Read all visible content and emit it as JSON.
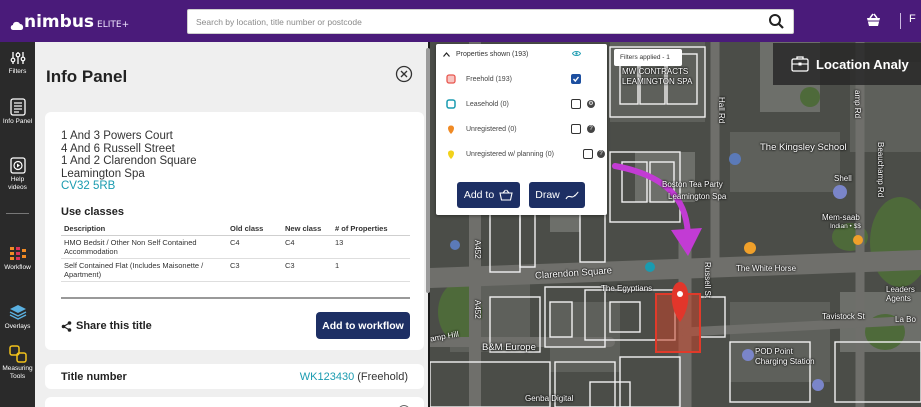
{
  "app": {
    "logo_text": "nimbus",
    "logo_badge": "ELITE+"
  },
  "search": {
    "placeholder": "Search by location, title number or postcode"
  },
  "topbar": {
    "trailing_text": "F"
  },
  "sidebar": {
    "items": [
      {
        "label": "Filters",
        "icon": "filters-icon"
      },
      {
        "label": "Info Panel",
        "icon": "info-panel-icon"
      },
      {
        "label": "Help videos",
        "icon": "help-videos-icon"
      },
      {
        "label": "Workflow",
        "icon": "workflow-icon"
      },
      {
        "label": "Overlays",
        "icon": "overlays-icon"
      },
      {
        "label": "Measuring Tools",
        "icon": "measuring-tools-icon"
      }
    ]
  },
  "panel": {
    "title": "Info Panel",
    "address": [
      "1 And 3 Powers Court",
      "4 And 6 Russell Street",
      "1 And 2 Clarendon Square",
      "Leamington Spa"
    ],
    "postcode": "CV32 5RB",
    "use_classes": {
      "title": "Use classes",
      "headers": [
        "Description",
        "Old class",
        "New class",
        "# of Properties"
      ],
      "rows": [
        [
          "HMO Bedsit / Other Non Self Contained Accommodation",
          "C4",
          "C4",
          "13"
        ],
        [
          "Self Contained Flat (Includes Maisonette / Apartment)",
          "C3",
          "C3",
          "1"
        ]
      ]
    },
    "share_label": "Share this title",
    "workflow_button": "Add to workflow",
    "title_number": {
      "label": "Title number",
      "value": "WK123430",
      "tenure": " (Freehold)"
    }
  },
  "properties": {
    "header": "Properties shown (193)",
    "rows": [
      {
        "label": "Freehold (193)",
        "checked": true,
        "symbol": "freehold-square-icon",
        "color": "#e8574f"
      },
      {
        "label": "Leasehold (0)",
        "checked": false,
        "symbol": "leasehold-square-icon",
        "color": "#1a9bb0"
      },
      {
        "label": "Unregistered (0)",
        "checked": false,
        "symbol": "unregistered-pin-icon",
        "color": "#f08a24"
      },
      {
        "label": "Unregistered w/ planning (0)",
        "checked": false,
        "symbol": "planning-pin-icon",
        "color": "#f2d21b"
      }
    ],
    "add_button": "Add to",
    "draw_button": "Draw"
  },
  "filters_applied": "Filters applied - 1",
  "location_analysis": "Location Analy",
  "map_labels": {
    "hall_rd": "Hall Rd",
    "the_kingsley_school": "The Kingsley School",
    "beauchamp_rd": "Beauchamp Rd",
    "boston_tea_party": "Boston Tea Party",
    "leamington_spa": "Leamington Spa",
    "shell": "Shell",
    "mem_saab": "Mem-saab",
    "indian": "Indian • $$",
    "a452_top": "A452",
    "a452_mid": "A452",
    "clarendon_square": "Clarendon Square",
    "russell_st": "Russell St",
    "the_white_horse": "The White Horse",
    "the_egyptians": "The Egyptians",
    "pavistock_st": "Tavistock St",
    "leaders_agents": "Leaders Agents",
    "la_bo": "La Bo",
    "bm_europe": "B&M Europe",
    "camp_hill": "amp Hill",
    "pod_point": "POD Point",
    "charging_station": "Charging Station",
    "genba_digital": "Genba Digital",
    "mw_contracts": "MW CONTRACTS",
    "leamington_spa_top": "LEAMINGTON SPA",
    "amp_rd": "amp Rd"
  }
}
